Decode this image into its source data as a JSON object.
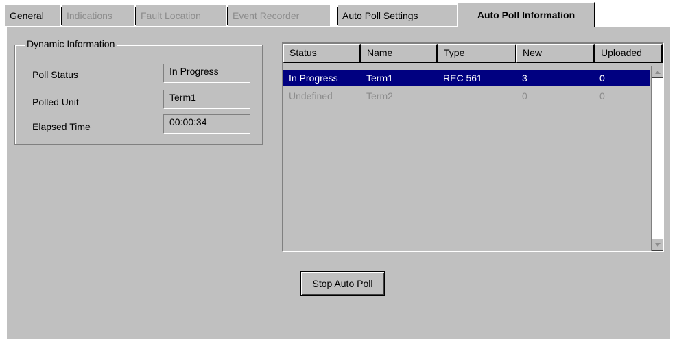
{
  "tabs": [
    {
      "label": "General",
      "state": "normal"
    },
    {
      "label": "Indications",
      "state": "disabled"
    },
    {
      "label": "Fault Location",
      "state": "disabled"
    },
    {
      "label": "Event Recorder",
      "state": "disabled"
    },
    {
      "label": "Auto Poll Settings",
      "state": "normal"
    },
    {
      "label": "Auto Poll Information",
      "state": "active"
    }
  ],
  "dynamic_info": {
    "title": "Dynamic Information",
    "fields": [
      {
        "label": "Poll Status",
        "value": "In Progress"
      },
      {
        "label": "Polled Unit",
        "value": "Term1"
      },
      {
        "label": "Elapsed Time",
        "value": "00:00:34"
      }
    ]
  },
  "list": {
    "columns": [
      "Status",
      "Name",
      "Type",
      "New",
      "Uploaded"
    ],
    "rows": [
      {
        "status": "In Progress",
        "name": "Term1",
        "type": "REC 561",
        "new": "3",
        "uploaded": "0",
        "state": "selected"
      },
      {
        "status": "Undefined",
        "name": "Term2",
        "type": "",
        "new": "0",
        "uploaded": "0",
        "state": "disabled"
      }
    ]
  },
  "buttons": {
    "stop_auto_poll": "Stop Auto Poll"
  },
  "colors": {
    "selection": "#000080",
    "face": "#c0c0c0",
    "disabled_text": "#8c8c8c"
  }
}
